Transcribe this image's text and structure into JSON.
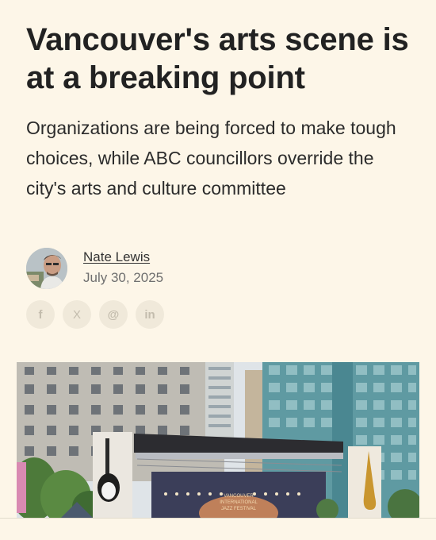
{
  "article": {
    "headline": "Vancouver's arts scene is at a breaking point",
    "dek": "Organizations are being forced to make tough choices, while ABC councillors override the city's arts and culture committee",
    "author": "Nate Lewis",
    "date": "July 30, 2025"
  },
  "share": [
    {
      "icon": "facebook-icon",
      "glyph": "f"
    },
    {
      "icon": "x-icon",
      "glyph": "X"
    },
    {
      "icon": "threads-icon",
      "glyph": "@"
    },
    {
      "icon": "linkedin-icon",
      "glyph": "in"
    }
  ],
  "hero_image": {
    "banner_text_1": "VANCOUVER",
    "banner_text_2": "INTERNATIONAL",
    "banner_text_3": "JAZZ FESTIVAL"
  },
  "colors": {
    "background": "#fdf6e8",
    "share_button_bg": "#f0e9da",
    "share_icon": "#c3bcad"
  }
}
